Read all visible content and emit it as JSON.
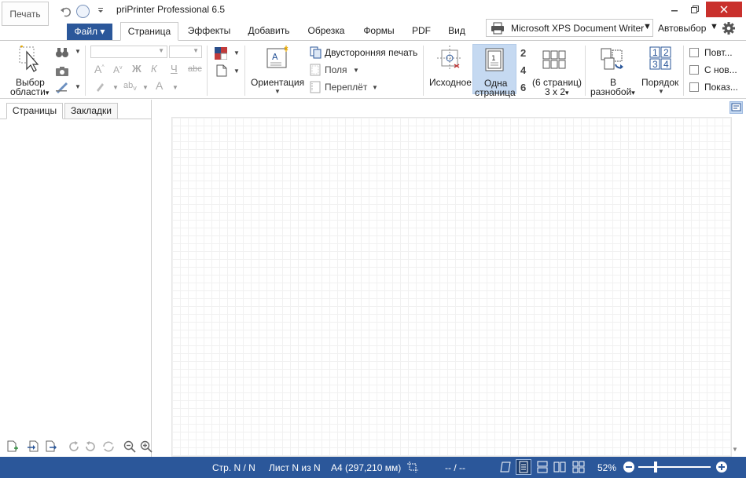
{
  "app": {
    "title": "priPrinter Professional 6.5",
    "print_button": "Печать"
  },
  "tabs": [
    {
      "label": "Файл"
    },
    {
      "label": "Страница"
    },
    {
      "label": "Эффекты"
    },
    {
      "label": "Добавить"
    },
    {
      "label": "Обрезка"
    },
    {
      "label": "Формы"
    },
    {
      "label": "PDF"
    },
    {
      "label": "Вид"
    }
  ],
  "printer": {
    "name": "Microsoft XPS Document Writer",
    "paper_mode": "Автовыбор"
  },
  "ribbon": {
    "select_area": {
      "line1": "Выбор",
      "line2": "области"
    },
    "orientation": "Ориентация",
    "duplex": "Двусторонняя печать",
    "margins": "Поля",
    "binding": "Переплёт",
    "original": "Исходное",
    "one_page": {
      "line1": "Одна",
      "line2": "страница"
    },
    "pages_per_sheet": {
      "n1": "2",
      "n2": "4",
      "n3": "6"
    },
    "six_pages": {
      "line1": "(6 страниц)",
      "line2": "3 x 2"
    },
    "scatter": {
      "line1": "В",
      "line2": "разнобой"
    },
    "order": "Порядок",
    "order_nums": [
      "1",
      "2",
      "3",
      "4"
    ],
    "check1": "Повт...",
    "check2": "С нов...",
    "check3": "Показ..."
  },
  "left_panel": {
    "tab_pages": "Страницы",
    "tab_bookmarks": "Закладки"
  },
  "status": {
    "page": "Стр. N / N",
    "sheet": "Лист N из N",
    "paper": "A4 (297,210 мм)",
    "coords": "-- / --",
    "zoom": "52%"
  },
  "colors": {
    "accent": "#2b579a",
    "close": "#c9302c",
    "selected_button": "#c5d9f1"
  }
}
